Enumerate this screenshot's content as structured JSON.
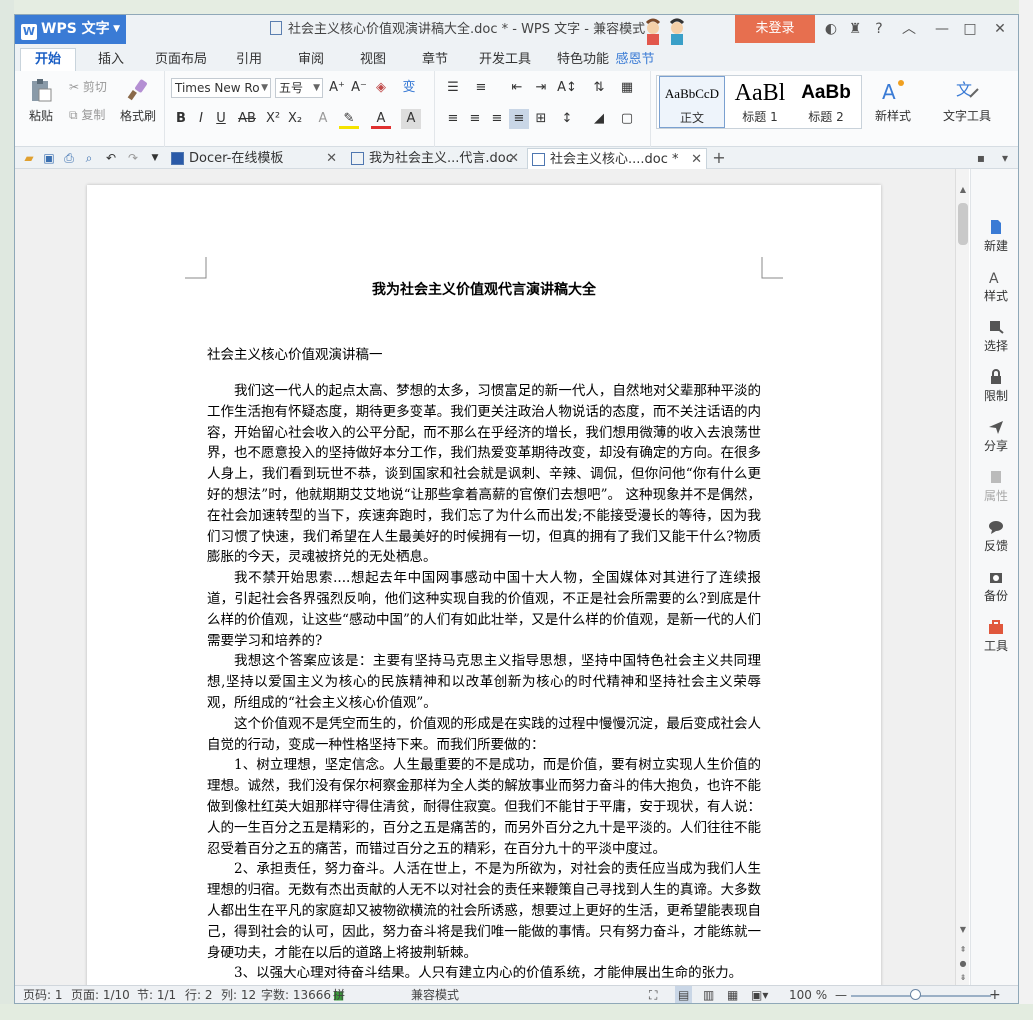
{
  "app": {
    "name": "WPS 文字",
    "title": "社会主义核心价值观演讲稿大全.doc * - WPS 文字 - 兼容模式",
    "login": "未登录",
    "festival": "感恩节"
  },
  "menu_tabs": [
    "开始",
    "插入",
    "页面布局",
    "引用",
    "审阅",
    "视图",
    "章节",
    "开发工具",
    "特色功能"
  ],
  "ribbon": {
    "paste": "粘贴",
    "cut": "剪切",
    "copy": "复制",
    "format_painter": "格式刷",
    "font_name": "Times New Ro",
    "font_size": "五号",
    "styles": [
      {
        "preview": "AaBbCcD",
        "label": "正文"
      },
      {
        "preview": "AaBl",
        "label": "标题 1"
      },
      {
        "preview": "AaBb",
        "label": "标题 2"
      }
    ],
    "new_style": "新样式",
    "text_tools": "文字工具"
  },
  "doc_tabs": [
    {
      "label": "Docer-在线模板",
      "active": false
    },
    {
      "label": "我为社会主义...代言.doc",
      "active": false
    },
    {
      "label": "社会主义核心....doc *",
      "active": true
    }
  ],
  "document": {
    "title": "我为社会主义价值观代言演讲稿大全",
    "subheading": "社会主义核心价值观演讲稿一",
    "paragraphs": [
      "我们这一代人的起点太高、梦想的太多，习惯富足的新一代人，自然地对父辈那种平淡的工作生活抱有怀疑态度，期待更多变革。我们更关注政治人物说话的态度，而不关注话语的内容，开始留心社会收入的公平分配，而不那么在乎经济的增长，我们想用微薄的收入去浪荡世界，也不愿意投入的坚持做好本分工作，我们热爱变革期待改变，却没有确定的方向。在很多人身上，我们看到玩世不恭，谈到国家和社会就是讽刺、辛辣、调侃，但你问他“你有什么更好的想法”时，他就期期艾艾地说“让那些拿着高薪的官僚们去想吧”。 这种现象并不是偶然，在社会加速转型的当下，疾速奔跑时，我们忘了为什么而出发;不能接受漫长的等待，因为我们习惯了快速，我们希望在人生最美好的时候拥有一切，但真的拥有了我们又能干什么?物质膨胀的今天，灵魂被挤兑的无处栖息。",
      "我不禁开始思索....想起去年中国网事感动中国十大人物，全国媒体对其进行了连续报道，引起社会各界强烈反响，他们这种实现自我的价值观，不正是社会所需要的么?到底是什么样的价值观，让这些“感动中国”的人们有如此壮举，又是什么样的价值观，是新一代的人们需要学习和培养的?",
      "我想这个答案应该是：主要有坚持马克思主义指导思想，坚持中国特色社会主义共同理想,坚持以爱国主义为核心的民族精神和以改革创新为核心的时代精神和坚持社会主义荣辱观，所组成的“社会主义核心价值观”。",
      "这个价值观不是凭空而生的，价值观的形成是在实践的过程中慢慢沉淀，最后变成社会人自觉的行动，变成一种性格坚持下来。而我们所要做的：",
      "1、树立理想，坚定信念。人生最重要的不是成功，而是价值，要有树立实现人生价值的理想。诚然，我们没有保尔柯察金那样为全人类的解放事业而努力奋斗的伟大抱负，也许不能做到像杜红英大姐那样守得住清贫，耐得住寂寞。但我们不能甘于平庸，安于现状，有人说：人的一生百分之五是精彩的，百分之五是痛苦的，而另外百分之九十是平淡的。人们往往不能忍受着百分之五的痛苦，而错过百分之五的精彩，在百分九十的平淡中度过。",
      "2、承担责任，努力奋斗。人活在世上，不是为所欲为，对社会的责任应当成为我们人生理想的归宿。无数有杰出贡献的人无不以对社会的责任来鞭策自己寻找到人生的真谛。大多数人都出生在平凡的家庭却又被物欲横流的社会所诱惑，想要过上更好的生活，更希望能表现自己，得到社会的认可，因此，努力奋斗将是我们唯一能做的事情。只有努力奋斗，才能练就一身硬功夫，才能在以后的道路上将披荆斩棘。",
      "3、以强大心理对待奋斗结果。人只有建立内心的价值系统，才能伸展出生命的张力。"
    ]
  },
  "side_panel": [
    "新建",
    "样式",
    "选择",
    "限制",
    "分享",
    "属性",
    "反馈",
    "备份",
    "工具"
  ],
  "status": {
    "page": "页码: 1",
    "pages": "页面: 1/10",
    "section": "节: 1/1",
    "row": "行: 2",
    "col": "列: 12",
    "words": "字数: 13666",
    "spell": "拼写检查",
    "mode": "兼容模式",
    "zoom": "100 %"
  },
  "colors": {
    "accent": "#3a7bd5",
    "login": "#e76f4f"
  }
}
